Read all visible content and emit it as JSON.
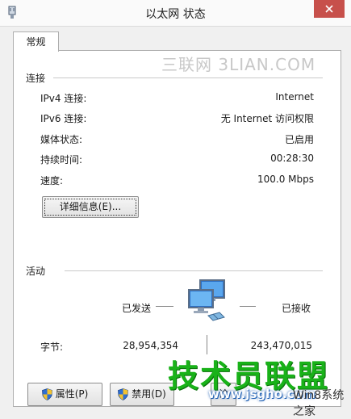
{
  "window": {
    "title": "以太网 状态",
    "close_glyph": "✕"
  },
  "tabs": [
    {
      "label": "常规"
    }
  ],
  "watermark_top": "三联网 3LIAN.COM",
  "connection": {
    "heading": "连接",
    "rows": [
      {
        "label": "IPv4 连接:",
        "value": "Internet"
      },
      {
        "label": "IPv6 连接:",
        "value": "无 Internet 访问权限"
      },
      {
        "label": "媒体状态:",
        "value": "已启用"
      },
      {
        "label": "持续时间:",
        "value": "00:28:30"
      },
      {
        "label": "速度:",
        "value": "100.0 Mbps"
      }
    ],
    "details_button": "详细信息(E)..."
  },
  "activity": {
    "heading": "活动",
    "sent_label": "已发送",
    "received_label": "已接收",
    "bytes_label": "字节:",
    "bytes_sent": "28,954,354",
    "bytes_received": "243,470,015"
  },
  "buttons": {
    "properties": "属性(P)",
    "disable": "禁用(D)",
    "diagnose": "诊"
  },
  "watermark_bottom": {
    "brand": "技术员联盟",
    "url": "www.jsgho.com",
    "suffix": "Win8系统之家"
  },
  "colors": {
    "close_button": "#c7504b",
    "watermark_green": "#19b219",
    "shield_blue": "#2f6fd1",
    "shield_yellow": "#f2c230"
  },
  "icons": {
    "title": "network-adapter-icon",
    "activity": "network-computers-icon",
    "shield": "uac-shield-icon"
  }
}
